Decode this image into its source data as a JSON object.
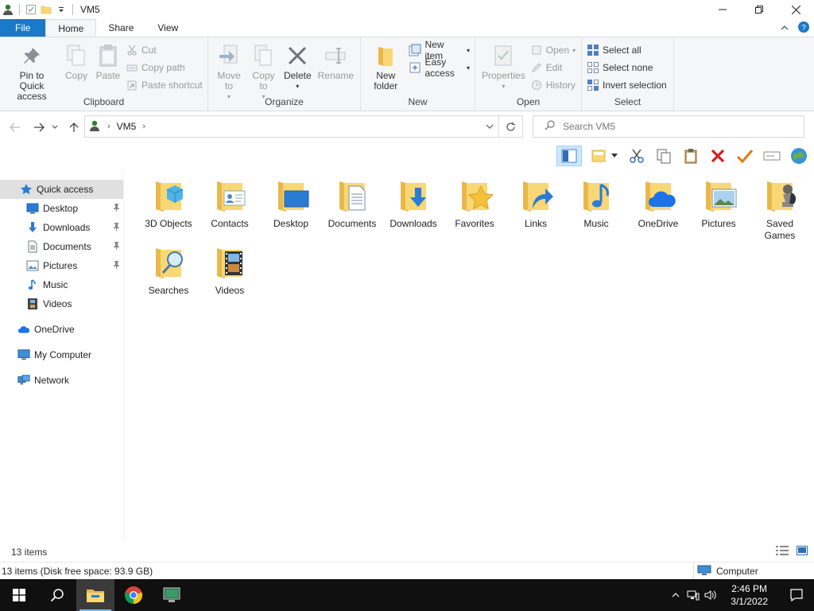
{
  "window": {
    "title": "VM5"
  },
  "tabs": [
    {
      "label": "File"
    },
    {
      "label": "Home"
    },
    {
      "label": "Share"
    },
    {
      "label": "View"
    }
  ],
  "ribbon": {
    "clipboard": {
      "label": "Clipboard",
      "pin": "Pin to Quick access",
      "copy": "Copy",
      "paste": "Paste",
      "cut": "Cut",
      "copy_path": "Copy path",
      "paste_shortcut": "Paste shortcut"
    },
    "organize": {
      "label": "Organize",
      "move_to": "Move to",
      "copy_to": "Copy to",
      "delete": "Delete",
      "rename": "Rename"
    },
    "new": {
      "label": "New",
      "new_folder": "New folder",
      "new_item": "New item",
      "easy_access": "Easy access"
    },
    "open": {
      "label": "Open",
      "properties": "Properties",
      "open": "Open",
      "edit": "Edit",
      "history": "History"
    },
    "select": {
      "label": "Select",
      "select_all": "Select all",
      "select_none": "Select none",
      "invert": "Invert selection"
    }
  },
  "address": {
    "path": "VM5",
    "search_placeholder": "Search VM5"
  },
  "nav": {
    "quick_access": "Quick access",
    "items": [
      {
        "label": "Desktop",
        "icon": "desktop-icon",
        "pinned": true
      },
      {
        "label": "Downloads",
        "icon": "download-icon",
        "pinned": true
      },
      {
        "label": "Documents",
        "icon": "document-icon",
        "pinned": true
      },
      {
        "label": "Pictures",
        "icon": "picture-icon",
        "pinned": true
      },
      {
        "label": "Music",
        "icon": "music-icon",
        "pinned": false
      },
      {
        "label": "Videos",
        "icon": "video-icon",
        "pinned": false
      }
    ],
    "onedrive": "OneDrive",
    "my_computer": "My Computer",
    "network": "Network"
  },
  "folders": [
    {
      "name": "3D Objects",
      "icon": "cube-icon"
    },
    {
      "name": "Contacts",
      "icon": "contact-card-icon"
    },
    {
      "name": "Desktop",
      "icon": "desktop-icon"
    },
    {
      "name": "Documents",
      "icon": "document-icon"
    },
    {
      "name": "Downloads",
      "icon": "download-arrow-icon"
    },
    {
      "name": "Favorites",
      "icon": "star-icon"
    },
    {
      "name": "Links",
      "icon": "link-arrow-icon"
    },
    {
      "name": "Music",
      "icon": "music-note-icon"
    },
    {
      "name": "OneDrive",
      "icon": "cloud-icon"
    },
    {
      "name": "Pictures",
      "icon": "picture-icon"
    },
    {
      "name": "Saved Games",
      "icon": "chess-piece-icon"
    },
    {
      "name": "Searches",
      "icon": "magnifier-icon"
    },
    {
      "name": "Videos",
      "icon": "film-icon"
    }
  ],
  "status": {
    "count": "13 items",
    "details": "13 items (Disk free space: 93.9 GB)",
    "zone": "Computer"
  },
  "taskbar": {
    "time": "2:46 PM",
    "date": "3/1/2022"
  },
  "colors": {
    "accent": "#1979ca",
    "folder": "#f8d775",
    "folder_dark": "#e8b84a",
    "taskbar": "#101010"
  }
}
